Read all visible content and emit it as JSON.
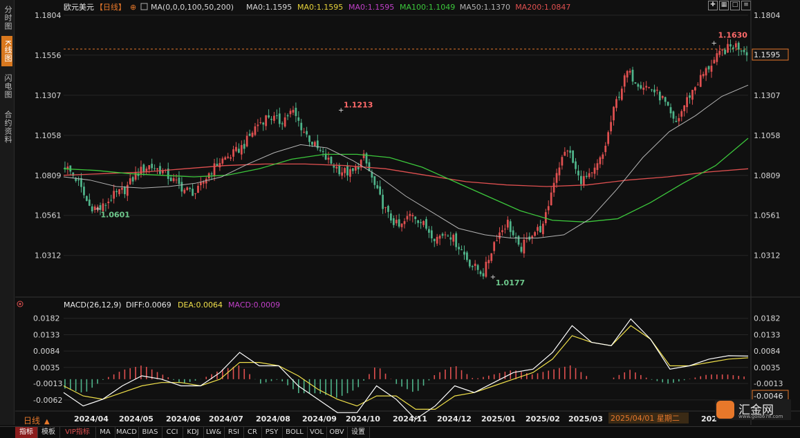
{
  "sidebar": {
    "tabs": [
      "分时图",
      "K线图",
      "闪电图",
      "合约资料"
    ],
    "active": 1
  },
  "header": {
    "symbol": "欧元美元",
    "period_tag": "【日线】",
    "ma_items": [
      {
        "text": "MA(0,0,0,100,50,200)",
        "color": "#d8d8d8"
      },
      {
        "text": "MA0:1.1595",
        "color": "#d8d8d8"
      },
      {
        "text": "MA0:1.1595",
        "color": "#e6d23a"
      },
      {
        "text": "MA0:1.1595",
        "color": "#c040c8"
      },
      {
        "text": "MA100:1.1049",
        "color": "#3cc83c"
      },
      {
        "text": "MA50:1.1370",
        "color": "#b4b4b4"
      },
      {
        "text": "MA200:1.0847",
        "color": "#e05050"
      }
    ]
  },
  "price_panel": {
    "axis_ticks": [
      "1.1804",
      "1.1556",
      "1.1307",
      "1.1058",
      "1.0809",
      "1.0561",
      "1.0312"
    ],
    "current_price": "1.1595",
    "high_marker": "1.1630",
    "marks": [
      {
        "text": "1.0601",
        "color": "#6ec88c"
      },
      {
        "text": "1.1213",
        "color": "#ff6a6a"
      },
      {
        "text": "1.0177",
        "color": "#6ec88c"
      }
    ]
  },
  "macd_panel": {
    "title": "MACD(26,12,9)",
    "diff": "DIFF:0.0069",
    "dea": "DEA:0.0064",
    "macd": "MACD:0.0009",
    "axis_ticks": [
      "0.0182",
      "0.0133",
      "0.0084",
      "0.0035",
      "-0.0013",
      "-0.0062"
    ],
    "current": "-0.0046"
  },
  "x_axis": {
    "labels": [
      "2024/04",
      "2024/05",
      "2024/06",
      "2024/07",
      "2024/08",
      "2024/09",
      "2024/10",
      "2024/11",
      "2024/12",
      "2025/01",
      "2025/02",
      "2025/03",
      "202"
    ],
    "cursor_label": "2025/04/01 星期二"
  },
  "bottom_tabs": [
    "指标",
    "模板",
    "VIP指标",
    "MA",
    "MACD",
    "BIAS",
    "CCI",
    "KDJ",
    "LW&",
    "RSI",
    "CR",
    "PSY",
    "BOLL",
    "VOL",
    "OBV",
    "设置"
  ],
  "period_label": "日线",
  "logo": {
    "name": "汇金网",
    "url": "www.gold678.com"
  },
  "colors": {
    "up": "#e05050",
    "down": "#4fb48a",
    "ma100": "#3cc83c",
    "ma50": "#b4b4b4",
    "ma200": "#e05050",
    "diff": "#ffffff",
    "dea": "#f0e04a",
    "accent": "#e8782a"
  },
  "chart_data": {
    "type": "candlestick",
    "title": "欧元美元 日线",
    "x_labels": [
      "2024/04",
      "2024/05",
      "2024/06",
      "2024/07",
      "2024/08",
      "2024/09",
      "2024/10",
      "2024/11",
      "2024/12",
      "2025/01",
      "2025/02",
      "2025/03",
      "202"
    ],
    "close_path": [
      1.087,
      1.078,
      1.062,
      1.06,
      1.068,
      1.072,
      1.082,
      1.087,
      1.084,
      1.078,
      1.072,
      1.07,
      1.082,
      1.09,
      1.094,
      1.1,
      1.112,
      1.118,
      1.114,
      1.121,
      1.108,
      1.098,
      1.09,
      1.084,
      1.082,
      1.092,
      1.072,
      1.056,
      1.048,
      1.058,
      1.05,
      1.042,
      1.046,
      1.036,
      1.025,
      1.02,
      1.042,
      1.052,
      1.034,
      1.045,
      1.049,
      1.082,
      1.098,
      1.078,
      1.08,
      1.094,
      1.125,
      1.145,
      1.138,
      1.135,
      1.128,
      1.112,
      1.128,
      1.14,
      1.15,
      1.158,
      1.162,
      1.158
    ],
    "y_range": [
      1.0062,
      1.1804
    ],
    "annotations": [
      {
        "label": "1.0601",
        "value": 1.0601
      },
      {
        "label": "1.1213",
        "value": 1.1213
      },
      {
        "label": "1.0177",
        "value": 1.0177
      },
      {
        "label": "1.1630",
        "value": 1.163
      }
    ],
    "current_price": 1.1595,
    "ma": {
      "MA50": [
        1.08,
        1.078,
        1.074,
        1.073,
        1.074,
        1.076,
        1.08,
        1.088,
        1.095,
        1.1,
        1.098,
        1.09,
        1.08,
        1.068,
        1.058,
        1.048,
        1.044,
        1.042,
        1.042,
        1.044,
        1.054,
        1.072,
        1.092,
        1.108,
        1.118,
        1.13,
        1.137
      ],
      "MA100": [
        1.085,
        1.084,
        1.082,
        1.081,
        1.08,
        1.081,
        1.085,
        1.091,
        1.094,
        1.094,
        1.092,
        1.086,
        1.077,
        1.068,
        1.059,
        1.053,
        1.052,
        1.054,
        1.064,
        1.076,
        1.087,
        1.104
      ],
      "MA200": [
        1.081,
        1.082,
        1.083,
        1.085,
        1.087,
        1.088,
        1.088,
        1.087,
        1.085,
        1.081,
        1.077,
        1.075,
        1.074,
        1.075,
        1.078,
        1.08,
        1.083,
        1.085
      ]
    },
    "macd": {
      "DIFF": [
        -0.004,
        -0.008,
        -0.006,
        -0.002,
        0.001,
        0.0,
        -0.002,
        -0.002,
        0.002,
        0.008,
        0.004,
        0.004,
        -0.002,
        -0.006,
        -0.01,
        -0.01,
        -0.002,
        -0.006,
        -0.012,
        -0.008,
        -0.002,
        -0.004,
        -0.001,
        0.002,
        0.003,
        0.008,
        0.016,
        0.011,
        0.01,
        0.018,
        0.012,
        0.003,
        0.004,
        0.006,
        0.007,
        0.0069
      ],
      "DEA": [
        -0.002,
        -0.005,
        -0.006,
        -0.004,
        -0.002,
        -0.001,
        -0.001,
        -0.002,
        0.0,
        0.005,
        0.005,
        0.004,
        0.001,
        -0.003,
        -0.006,
        -0.008,
        -0.005,
        -0.005,
        -0.009,
        -0.009,
        -0.005,
        -0.004,
        -0.002,
        0.0,
        0.002,
        0.006,
        0.013,
        0.011,
        0.01,
        0.016,
        0.012,
        0.004,
        0.004,
        0.005,
        0.006,
        0.0064
      ],
      "y_range": [
        -0.0085,
        0.02
      ]
    }
  }
}
